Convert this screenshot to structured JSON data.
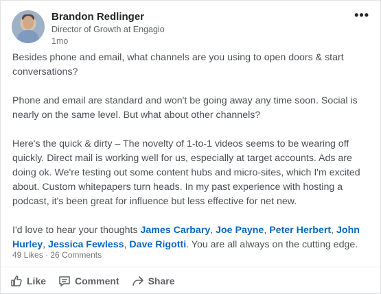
{
  "author": {
    "name": "Brandon Redlinger",
    "title": "Director of Growth at Engagio",
    "time": "1mo"
  },
  "post": {
    "p1": "Besides phone and email, what channels are you using to open doors & start conversations?",
    "p2": "Phone and email are standard and won't be going away any time soon. Social is nearly on the same level. But what about other channels?",
    "p3": "Here's the quick & dirty – The novelty of 1-to-1 videos seems to be wearing off quickly. Direct mail is working well for us, especially at target accounts. Ads are doing ok.  We're testing out some content hubs and micro-sites, which I'm excited about. Custom whitepapers turn heads. In my past experience with hosting a podcast, it's been great for influence but less effective for net new.",
    "p4_prefix": "I'd love to hear your thoughts ",
    "mentions": [
      "James Carbary",
      "Joe Payne",
      "Peter Herbert",
      "John Hurley",
      "Jessica Fewless",
      "Dave Rigotti"
    ],
    "p4_suffix": ". You are all always on the cutting edge."
  },
  "counts": {
    "likes": "49 Likes",
    "separator": " · ",
    "comments": "26 Comments"
  },
  "actions": {
    "like": "Like",
    "comment": "Comment",
    "share": "Share"
  }
}
